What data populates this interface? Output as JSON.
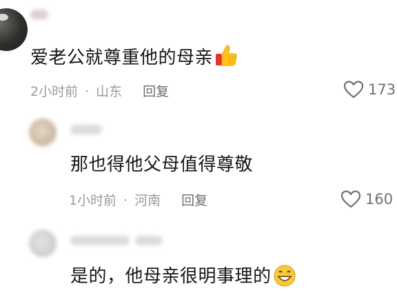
{
  "comments": [
    {
      "text": "爱老公就尊重他的母亲",
      "emoji": "thumbs-up-icon",
      "time": "2小时前",
      "location": "山东",
      "reply_label": "回复",
      "likes": "173"
    },
    {
      "text": "那也得他父母值得尊敬",
      "time": "1小时前",
      "location": "河南",
      "reply_label": "回复",
      "likes": "160"
    },
    {
      "text": "是的，他母亲很明事理的",
      "emoji": "grinning-face-icon"
    }
  ],
  "separator": "·",
  "colors": {
    "text": "#161616",
    "meta": "#9a9a9a",
    "like": "#707070"
  }
}
